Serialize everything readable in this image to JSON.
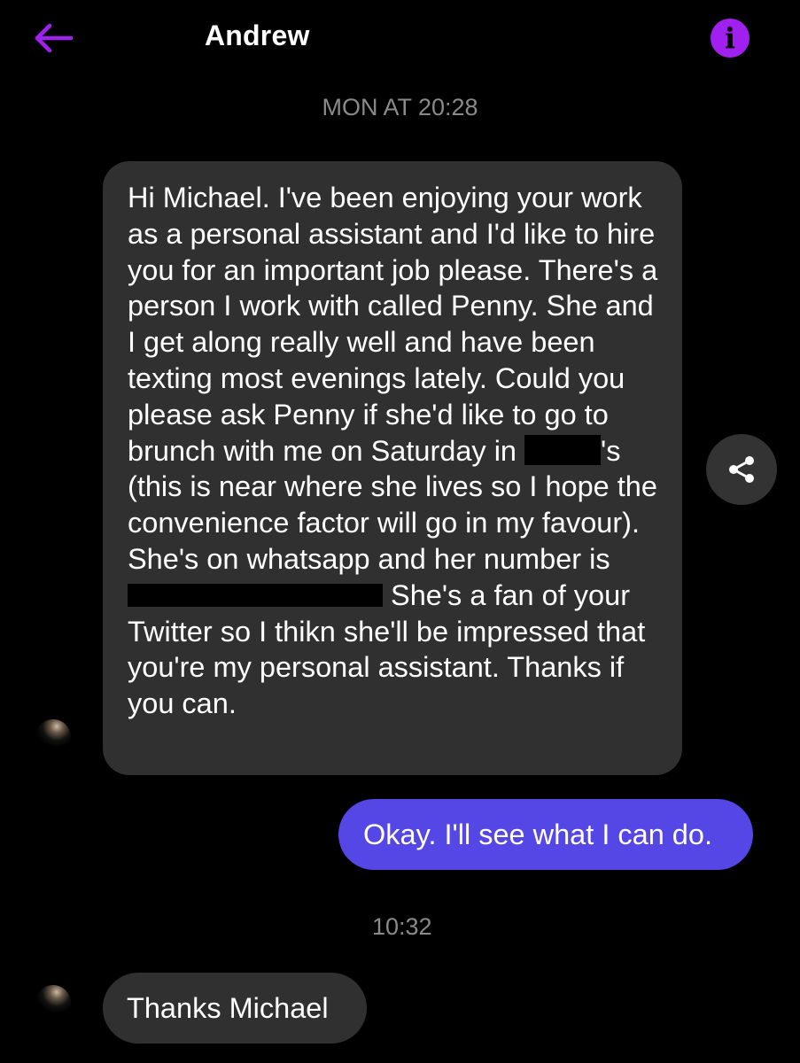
{
  "header": {
    "contact_name": "Andrew",
    "back_icon": "back-arrow-icon",
    "info_icon": "info-icon",
    "accent_color": "#a020f0"
  },
  "messages": {
    "timestamp_1": "MON AT 20:28",
    "incoming_1": {
      "line_1": "Hi Michael. I've been enjoying your work as a personal assistant and I'd like to hire you for an important job please. There's a person I work with called Penny. She and I get along really well and have been texting most evenings lately. Could you please ask Penny if she'd like to go to brunch with me on Saturday in ",
      "line_2": "'s (this is near where she lives so I hope the convenience factor will go in my favour). She's on whatsapp and her number is ",
      "line_3": " She's a fan of your Twitter so I thikn she'll be impressed that you're my personal assistant. Thanks if you can."
    },
    "outgoing_1": "Okay. I'll see what I can do.",
    "timestamp_2": "10:32",
    "incoming_2": "Thanks Michael",
    "outgoing_color": "#5546e6",
    "incoming_color": "#303030",
    "share_icon": "share-icon"
  }
}
